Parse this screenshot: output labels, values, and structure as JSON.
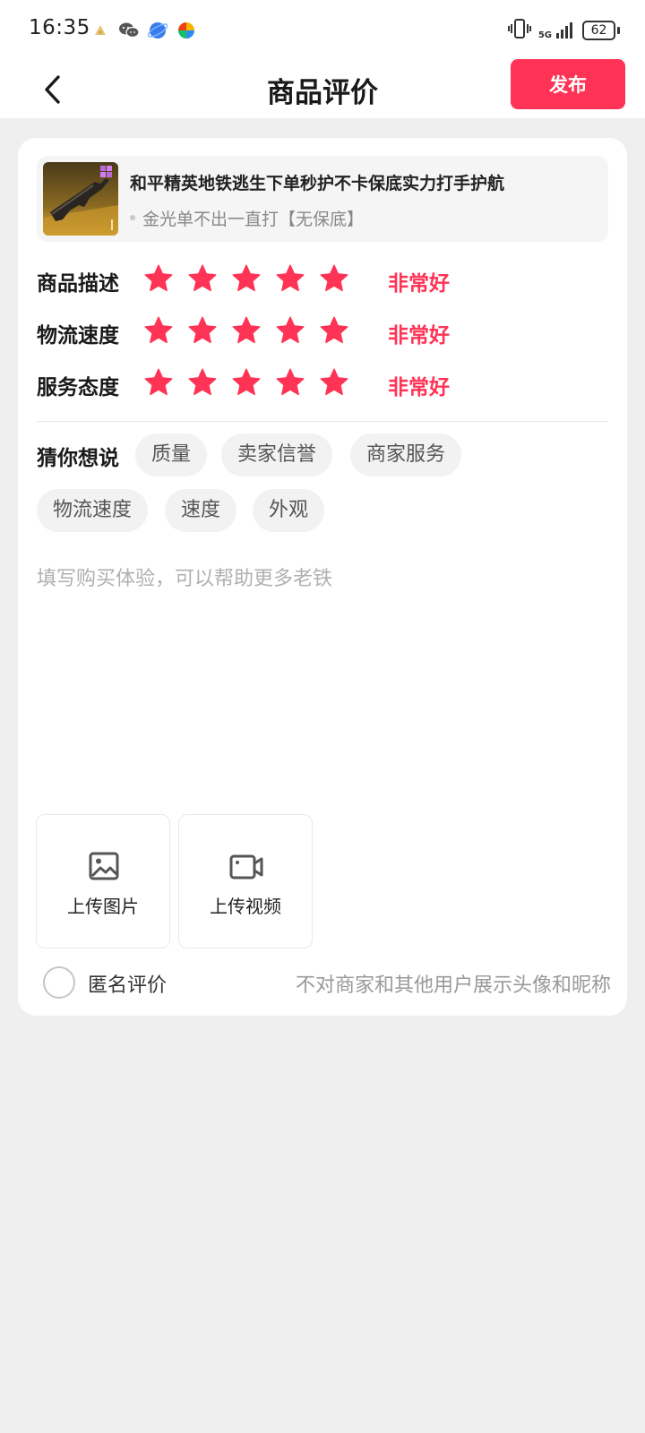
{
  "status_bar": {
    "time": "16:35",
    "network": "5G",
    "battery": "62",
    "app_icons": [
      "notification-icon",
      "wechat-icon",
      "browser-icon",
      "pinwheel-icon"
    ]
  },
  "nav": {
    "title": "商品评价",
    "publish_label": "发布"
  },
  "product": {
    "title": "和平精英地铁逃生下单秒护不卡保底实力打手护航",
    "spec": "金光单不出一直打【无保底】"
  },
  "ratings": [
    {
      "label": "商品描述",
      "stars": 5,
      "max": 5,
      "text": "非常好"
    },
    {
      "label": "物流速度",
      "stars": 5,
      "max": 5,
      "text": "非常好"
    },
    {
      "label": "服务态度",
      "stars": 5,
      "max": 5,
      "text": "非常好"
    }
  ],
  "suggestions": {
    "label": "猜你想说",
    "tags": [
      "质量",
      "卖家信誉",
      "商家服务",
      "物流速度",
      "速度",
      "外观"
    ]
  },
  "comment": {
    "placeholder": "填写购买体验，可以帮助更多老铁",
    "value": ""
  },
  "upload": {
    "image_label": "上传图片",
    "video_label": "上传视频"
  },
  "anonymous": {
    "label": "匿名评价",
    "hint": "不对商家和其他用户展示头像和昵称",
    "checked": false
  },
  "colors": {
    "accent": "#ff3355",
    "background": "#efefef"
  }
}
